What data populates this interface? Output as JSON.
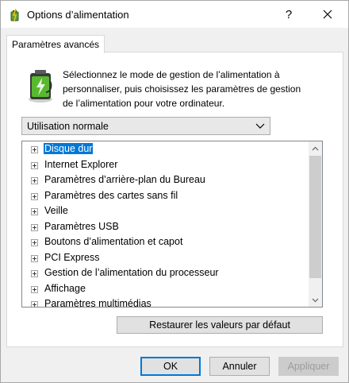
{
  "window": {
    "title": "Options d’alimentation",
    "help_label": "?",
    "icons": {
      "app": "power-options-icon",
      "close": "close-icon"
    }
  },
  "tabs": [
    {
      "label": "Paramètres avancés",
      "selected": true
    }
  ],
  "description": {
    "line1": "Sélectionnez le mode de gestion de l’alimentation à",
    "line2": "personnaliser, puis choisissez les paramètres de gestion",
    "line3": "de l’alimentation pour votre ordinateur."
  },
  "plan_select": {
    "value": "Utilisation normale"
  },
  "settings_tree": {
    "items": [
      {
        "label": "Disque dur",
        "selected": true
      },
      {
        "label": "Internet Explorer"
      },
      {
        "label": "Paramètres d’arrière-plan du Bureau"
      },
      {
        "label": "Paramètres des cartes sans fil"
      },
      {
        "label": "Veille"
      },
      {
        "label": "Paramètres USB"
      },
      {
        "label": "Boutons d’alimentation et capot"
      },
      {
        "label": "PCI Express"
      },
      {
        "label": "Gestion de l’alimentation du processeur"
      },
      {
        "label": "Affichage"
      },
      {
        "label": "Paramètres multimédias"
      }
    ]
  },
  "buttons": {
    "restore": "Restaurer les valeurs par défaut",
    "ok": "OK",
    "cancel": "Annuler",
    "apply": "Appliquer"
  },
  "colors": {
    "selection": "#0078d7",
    "default_button_border": "#0078d7"
  }
}
